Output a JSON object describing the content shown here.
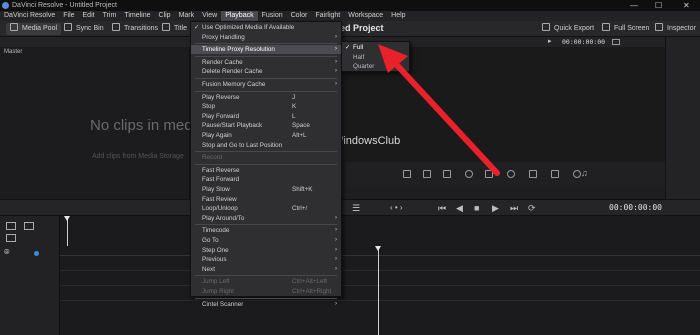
{
  "window": {
    "title": "DaVinci Resolve - Untitled Project"
  },
  "menubar": {
    "items": [
      "DaVinci Resolve",
      "File",
      "Edit",
      "Trim",
      "Timeline",
      "Clip",
      "Mark",
      "View",
      "Playback",
      "Fusion",
      "Color",
      "Fairlight",
      "Workspace",
      "Help"
    ],
    "active": "Playback"
  },
  "toolbar": {
    "media_pool": "Media Pool",
    "sync_bin": "Sync Bin",
    "transitions": "Transitions",
    "titles_partial": "Title",
    "project_title": "ed Project",
    "quick_export": "Quick Export",
    "full_screen": "Full Screen",
    "inspector": "Inspector"
  },
  "viewer": {
    "timecode_top": "00:00:00:00"
  },
  "media_pool": {
    "bin": "Master",
    "empty_title": "No clips in medi",
    "empty_hint": "Add clips from Media Storage"
  },
  "watermark": {
    "text": "TheWindowsClub"
  },
  "timeline": {
    "timecode": "00:00:00:00"
  },
  "playback_menu": {
    "items": [
      {
        "label": "Use Optimized Media If Available",
        "checked": true
      },
      {
        "label": "Proxy Handling",
        "submenu": true
      },
      {
        "sep": true
      },
      {
        "label": "Timeline Proxy Resolution",
        "submenu": true,
        "highlighted": true
      },
      {
        "sep": true
      },
      {
        "label": "Render Cache",
        "submenu": true
      },
      {
        "label": "Delete Render Cache",
        "submenu": true
      },
      {
        "sep": true
      },
      {
        "label": "Fusion Memory Cache",
        "submenu": true
      },
      {
        "sep": true
      },
      {
        "label": "Play Reverse",
        "shortcut": "J"
      },
      {
        "label": "Stop",
        "shortcut": "K"
      },
      {
        "label": "Play Forward",
        "shortcut": "L"
      },
      {
        "label": "Pause/Start Playback",
        "shortcut": "Space"
      },
      {
        "label": "Play Again",
        "shortcut": "Alt+L"
      },
      {
        "label": "Stop and Go to Last Position"
      },
      {
        "sep": true
      },
      {
        "label": "Record",
        "disabled": true
      },
      {
        "sep": true
      },
      {
        "label": "Fast Reverse"
      },
      {
        "label": "Fast Forward"
      },
      {
        "label": "Play Slow",
        "shortcut": "Shift+K"
      },
      {
        "label": "Fast Review"
      },
      {
        "label": "Loop/Unloop",
        "shortcut": "Ctrl+/"
      },
      {
        "label": "Play Around/To",
        "submenu": true
      },
      {
        "sep": true
      },
      {
        "label": "Timecode",
        "submenu": true
      },
      {
        "label": "Go To",
        "submenu": true
      },
      {
        "label": "Step One",
        "submenu": true
      },
      {
        "label": "Previous",
        "submenu": true
      },
      {
        "label": "Next",
        "submenu": true
      },
      {
        "sep": true
      },
      {
        "label": "Jump Left",
        "shortcut": "Ctrl+Alt+Left",
        "disabled": true
      },
      {
        "label": "Jump Right",
        "shortcut": "Ctrl+Alt+Right",
        "disabled": true
      },
      {
        "sep": true
      },
      {
        "label": "Cintel Scanner",
        "submenu": true
      }
    ]
  },
  "proxy_submenu": {
    "items": [
      {
        "label": "Full",
        "checked": true
      },
      {
        "label": "Half"
      },
      {
        "label": "Quarter"
      }
    ]
  },
  "annotation": {
    "arrow_color": "#e8212a"
  }
}
